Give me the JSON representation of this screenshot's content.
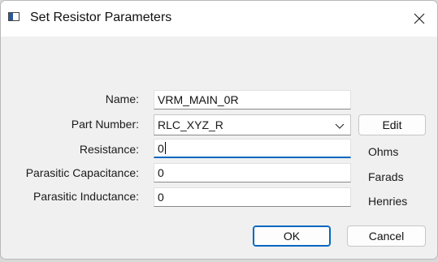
{
  "window": {
    "title": "Set Resistor Parameters"
  },
  "form": {
    "name_label": "Name:",
    "name_value": "VRM_MAIN_0R",
    "part_number_label": "Part Number:",
    "part_number_value": "RLC_XYZ_R",
    "edit_label": "Edit",
    "resistance_label": "Resistance:",
    "resistance_value": "0",
    "resistance_unit": "Ohms",
    "capacitance_label": "Parasitic Capacitance:",
    "capacitance_value": "0",
    "capacitance_unit": "Farads",
    "inductance_label": "Parasitic Inductance:",
    "inductance_value": "0",
    "inductance_unit": "Henries"
  },
  "buttons": {
    "ok_label": "OK",
    "cancel_label": "Cancel"
  },
  "colors": {
    "accent": "#0067c0"
  }
}
